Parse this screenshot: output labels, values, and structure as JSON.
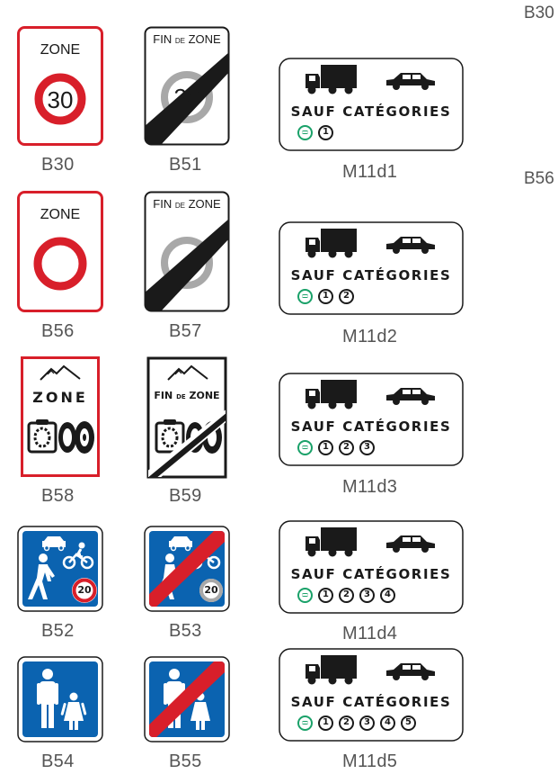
{
  "colors": {
    "red": "#d81f2a",
    "blue": "#0b63b0",
    "black": "#1a1a1a",
    "grey_ring": "#a8a8a8",
    "green": "#1aa169",
    "caption": "#555555"
  },
  "top_right_labels": [
    "B30",
    "B56"
  ],
  "col1": [
    {
      "code": "B30",
      "header": "ZONE",
      "speed": "30"
    },
    {
      "code": "B56",
      "header": "ZONE"
    },
    {
      "code": "B58",
      "header": "ZONE"
    },
    {
      "code": "B52",
      "speed": "20"
    },
    {
      "code": "B54"
    }
  ],
  "col2": [
    {
      "code": "B51",
      "fin": "FIN",
      "de": "DE",
      "zone": "ZONE",
      "speed": "30"
    },
    {
      "code": "B57",
      "fin": "FIN",
      "de": "DE",
      "zone": "ZONE"
    },
    {
      "code": "B59",
      "fin": "FIN",
      "de": "DE",
      "zone": "ZONE"
    },
    {
      "code": "B53",
      "speed": "20"
    },
    {
      "code": "B55"
    }
  ],
  "col3_text": "SAUF CATÉGORIES",
  "col3": [
    {
      "code": "M11d1",
      "categories": [
        "1"
      ]
    },
    {
      "code": "M11d2",
      "categories": [
        "1",
        "2"
      ]
    },
    {
      "code": "M11d3",
      "categories": [
        "1",
        "2",
        "3"
      ]
    },
    {
      "code": "M11d4",
      "categories": [
        "1",
        "2",
        "3",
        "4"
      ]
    },
    {
      "code": "M11d5",
      "categories": [
        "1",
        "2",
        "3",
        "4",
        "5"
      ]
    }
  ]
}
